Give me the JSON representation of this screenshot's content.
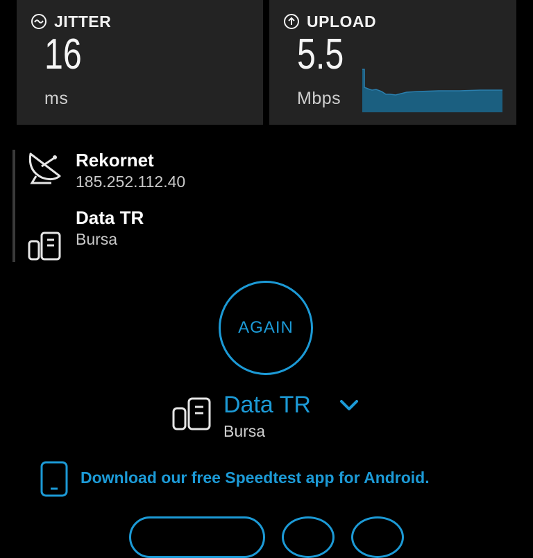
{
  "jitter": {
    "title": "JITTER",
    "value": "16",
    "unit": "ms",
    "icon": "jitter-icon"
  },
  "upload": {
    "title": "UPLOAD",
    "value": "5.5",
    "unit": "Mbps",
    "icon": "upload-arrow-icon"
  },
  "provider": {
    "name": "Rekornet",
    "ip": "185.252.112.40",
    "icon": "satellite-dish-icon"
  },
  "server": {
    "name": "Data TR",
    "location": "Bursa",
    "icon": "server-icon"
  },
  "again_label": "AGAIN",
  "selected_server": {
    "name": "Data TR",
    "location": "Bursa"
  },
  "download_banner": "Download our free Speedtest app for Android.",
  "colors": {
    "accent": "#1c9ad6",
    "card": "#232323",
    "graph": "#1b5f80",
    "background": "#000000"
  }
}
